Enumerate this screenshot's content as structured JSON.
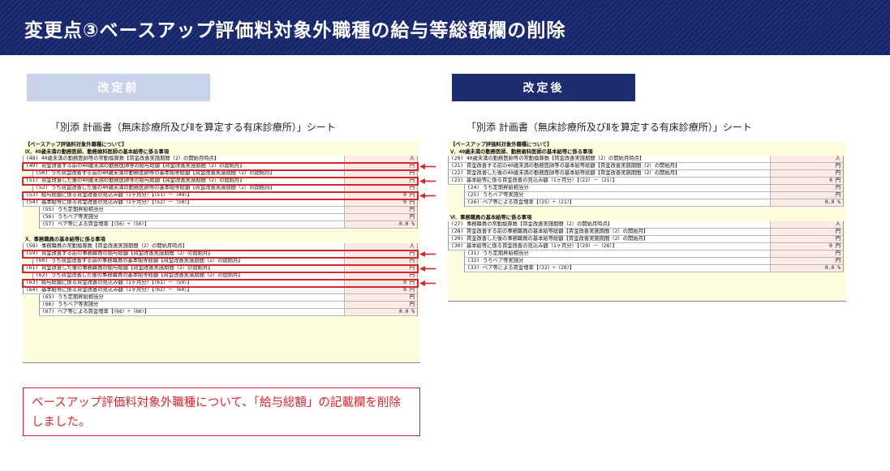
{
  "header": {
    "title": "変更点③ベースアップ評価料対象外職種の給与等総額欄の削除"
  },
  "labels": {
    "before": "改定前",
    "after": "改定後"
  },
  "sheet_label": "「別添 計画書（無床診療所及びⅡを算定する有床診療所）」シート",
  "before": {
    "top": "【ベースアップ評価料対象外職種について】",
    "sections": [
      {
        "title": "Ⅸ．40歳未満の勤務医師、勤務歯科医師の基本給等に係る事項",
        "rows": [
          {
            "label": "(48) 40歳未満の勤務医師等の常勤換算数【賃金改善実施期間（2）の開始月時点】",
            "value": "人",
            "indent": 0,
            "hl": false
          },
          {
            "label": "(49) 賃金改善する前の40歳未満の勤務医師等の給与総額【賃金改善実施期間（2）の開始月】",
            "value": "円",
            "indent": 0,
            "hl": true
          },
          {
            "label": "(50) うち賃金改善する前の40歳未満の勤務医師等の基本給等総額【賃金改善実施期間（2）の開始月】",
            "value": "円",
            "indent": 1,
            "hl": false
          },
          {
            "label": "(51) 賃金改善した後の40歳未満の勤務医師等の給与総額【賃金改善実施期間（2）の開始月】",
            "value": "円",
            "indent": 0,
            "hl": true
          },
          {
            "label": "(52) うち賃金改善した後の40歳未満の勤務医師等の基本給等総額【賃金改善実施期間（2）の開始月】",
            "value": "円",
            "indent": 1,
            "hl": false
          },
          {
            "label": "(53) 給与総額に係る賃金改善の見込み額（1ヶ月分）【（51）－（49）】",
            "value": "0 円",
            "indent": 0,
            "hl": true
          },
          {
            "label": "(54) 基本給等に係る賃金改善の見込み額（1ヶ月分）【（52）－（50）】",
            "value": "0 円",
            "indent": 0,
            "hl": false
          },
          {
            "label": "(55) うち定期昇給相当分",
            "value": "円",
            "indent": 2,
            "hl": false
          },
          {
            "label": "(56) うちベア等実施分",
            "value": "円",
            "indent": 2,
            "hl": false
          },
          {
            "label": "(57) ベア等による賃金増率【（56）÷（50）】",
            "value": "0.0 %",
            "indent": 2,
            "hl": false
          }
        ]
      },
      {
        "title": "Ⅹ．事務職員の基本給等に係る事項",
        "rows": [
          {
            "label": "(58) 事務職員の常勤換算数【賃金改善実施期間（2）の開始月時点】",
            "value": "人",
            "indent": 0,
            "hl": false
          },
          {
            "label": "(59) 賃金改善する前の事務職員の給与総額【賃金改善実施期間（2）の開始月】",
            "value": "円",
            "indent": 0,
            "hl": true
          },
          {
            "label": "(60) うち賃金改善する前の事務職員の基本給等総額【賃金改善実施期間（2）の開始月】",
            "value": "円",
            "indent": 1,
            "hl": false
          },
          {
            "label": "(61) 賃金改善した後の事務職員の給与総額【賃金改善実施期間（2）の開始月】",
            "value": "円",
            "indent": 0,
            "hl": true
          },
          {
            "label": "(62) うち賃金改善した後の事務職員の基本給等総額【賃金改善実施期間（2）の開始月】",
            "value": "円",
            "indent": 1,
            "hl": false
          },
          {
            "label": "(63) 給与総額に係る賃金改善の見込み額（1ヶ月分）【（61）－（59）】",
            "value": "0 円",
            "indent": 0,
            "hl": true
          },
          {
            "label": "(64) 基本給等に係る賃金改善の見込み額（1ヶ月分）【（62）－（60）】",
            "value": "0 円",
            "indent": 0,
            "hl": false
          },
          {
            "label": "(65) うち定期昇給相当分",
            "value": "円",
            "indent": 2,
            "hl": false
          },
          {
            "label": "(66) うちベア等実施分",
            "value": "円",
            "indent": 2,
            "hl": false
          },
          {
            "label": "(67) ベア等による賃金増率【（66）÷（60）】",
            "value": "0.0 %",
            "indent": 2,
            "hl": false
          }
        ]
      }
    ]
  },
  "after": {
    "top": "【ベースアップ評価料対象外職種について】",
    "sections": [
      {
        "title": "Ⅴ．40歳未満の勤務医師、勤務歯科医師の基本給等に係る事項",
        "rows": [
          {
            "label": "(20) 40歳未満の勤務医師等の常勤換算数【賃金改善実施期間（2）の開始月時点】",
            "value": "人",
            "indent": 0,
            "hl": false
          },
          {
            "label": "(21) 賃金改善する前の40歳未満の勤務医師等の基本給等総額【賃金改善実施期間（2）の開始月】",
            "value": "円",
            "indent": 0,
            "hl": false
          },
          {
            "label": "(22) 賃金改善した後の40歳未満の勤務医師等の基本給等総額【賃金改善実施期間（2）の開始月】",
            "value": "円",
            "indent": 0,
            "hl": false
          },
          {
            "label": "(23) 基本給等に係る賃金改善の見込み額（1ヶ月分）【（22）－（21）】",
            "value": "0 円",
            "indent": 0,
            "hl": false
          },
          {
            "label": "(24) うち定期昇給相当分",
            "value": "円",
            "indent": 2,
            "hl": false
          },
          {
            "label": "(25) うちベア等実施分",
            "value": "円",
            "indent": 2,
            "hl": false
          },
          {
            "label": "(26) ベア等による賃金増率【（25）÷（21）】",
            "value": "0.0 %",
            "indent": 2,
            "hl": false
          }
        ]
      },
      {
        "title": "Ⅵ．事務職員の基本給等に係る事項",
        "rows": [
          {
            "label": "(27) 事務職員の常勤換算数【賃金改善実施期間（2）の開始月時点】",
            "value": "人",
            "indent": 0,
            "hl": false
          },
          {
            "label": "(28) 賃金改善する前の事務職員の基本給等総額【賃金改善実施期間（2）の開始月】",
            "value": "円",
            "indent": 0,
            "hl": false
          },
          {
            "label": "(29) 賃金改善した後の事務職員の基本給等総額【賃金改善実施期間（2）の開始月】",
            "value": "円",
            "indent": 0,
            "hl": false
          },
          {
            "label": "(30) 基本給等に係る賃金改善の見込み額（1ヶ月分）【（29）－（28）】",
            "value": "0 円",
            "indent": 0,
            "hl": false
          },
          {
            "label": "(31) うち定期昇給相当分",
            "value": "円",
            "indent": 2,
            "hl": false
          },
          {
            "label": "(32) うちベア等実施分",
            "value": "円",
            "indent": 2,
            "hl": false
          },
          {
            "label": "(33) ベア等による賃金増率【（32）÷（28）】",
            "value": "0.0 %",
            "indent": 2,
            "hl": false
          }
        ]
      }
    ]
  },
  "note": "ベースアップ評価料対象外職種について、「給与総額」の記載欄を削除しました。",
  "colors": {
    "header_bg": "#16266a",
    "after_label_bg": "#1c2c6f",
    "before_label_bg": "#c8d3ea",
    "highlight": "#d9252b",
    "sheet_bg": "#fffde0",
    "value_bg": "#fde9e5"
  }
}
